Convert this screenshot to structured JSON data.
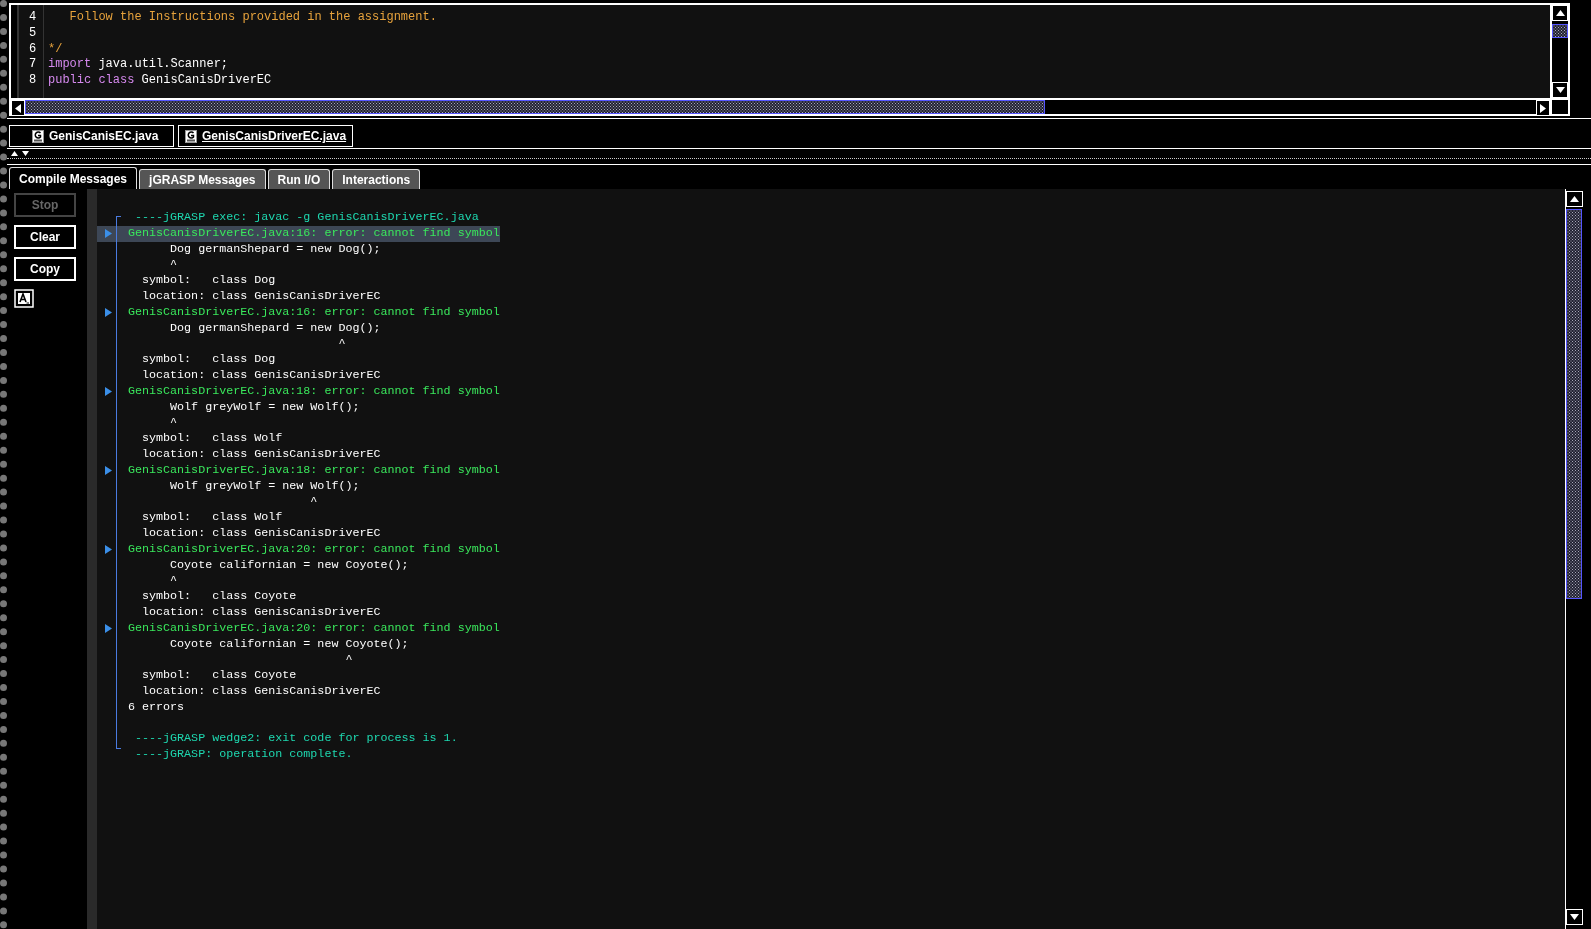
{
  "editor": {
    "lines": [
      {
        "number": "4",
        "tokens": [
          {
            "kind": "comment",
            "text": "   Follow the Instructions provided in the assignment."
          }
        ]
      },
      {
        "number": "5"
      },
      {
        "number": "6",
        "tokens": [
          {
            "kind": "comment",
            "text": "*/"
          }
        ]
      },
      {
        "number": "7",
        "tokens": [
          {
            "kind": "keyword",
            "text": "import"
          },
          {
            "kind": "plain",
            "text": " java.util.Scanner;"
          }
        ]
      },
      {
        "number": "8",
        "tokens": [
          {
            "kind": "keyword",
            "text": "public class"
          },
          {
            "kind": "plain",
            "text": " GenisCanisDriverEC"
          }
        ]
      }
    ]
  },
  "file_tabs": [
    {
      "label": "GenisCanisEC.java",
      "selected": false
    },
    {
      "label": "GenisCanisDriverEC.java",
      "selected": true
    }
  ],
  "tabs": [
    {
      "label": "Compile Messages",
      "selected": true
    },
    {
      "label": "jGRASP Messages",
      "selected": false
    },
    {
      "label": "Run I/O",
      "selected": false
    },
    {
      "label": "Interactions",
      "selected": false
    }
  ],
  "buttons": [
    {
      "label": "Stop",
      "disabled": true
    },
    {
      "label": "Clear",
      "disabled": false
    },
    {
      "label": "Copy",
      "disabled": false
    }
  ],
  "messages": [
    {
      "kind": "status",
      "text": " ----jGRASP exec: javac -g GenisCanisDriverEC.java"
    },
    {
      "kind": "error",
      "text": "GenisCanisDriverEC.java:16: error: cannot find symbol",
      "selected": true
    },
    {
      "kind": "plain",
      "text": "      Dog germanShepard = new Dog();"
    },
    {
      "kind": "plain",
      "text": "      ^"
    },
    {
      "kind": "plain",
      "text": "  symbol:   class Dog"
    },
    {
      "kind": "plain",
      "text": "  location: class GenisCanisDriverEC"
    },
    {
      "kind": "error",
      "text": "GenisCanisDriverEC.java:16: error: cannot find symbol",
      "selected": false
    },
    {
      "kind": "plain",
      "text": "      Dog germanShepard = new Dog();"
    },
    {
      "kind": "plain",
      "text": "                              ^"
    },
    {
      "kind": "plain",
      "text": "  symbol:   class Dog"
    },
    {
      "kind": "plain",
      "text": "  location: class GenisCanisDriverEC"
    },
    {
      "kind": "error",
      "text": "GenisCanisDriverEC.java:18: error: cannot find symbol",
      "selected": false
    },
    {
      "kind": "plain",
      "text": "      Wolf greyWolf = new Wolf();"
    },
    {
      "kind": "plain",
      "text": "      ^"
    },
    {
      "kind": "plain",
      "text": "  symbol:   class Wolf"
    },
    {
      "kind": "plain",
      "text": "  location: class GenisCanisDriverEC"
    },
    {
      "kind": "error",
      "text": "GenisCanisDriverEC.java:18: error: cannot find symbol",
      "selected": false
    },
    {
      "kind": "plain",
      "text": "      Wolf greyWolf = new Wolf();"
    },
    {
      "kind": "plain",
      "text": "                          ^"
    },
    {
      "kind": "plain",
      "text": "  symbol:   class Wolf"
    },
    {
      "kind": "plain",
      "text": "  location: class GenisCanisDriverEC"
    },
    {
      "kind": "error",
      "text": "GenisCanisDriverEC.java:20: error: cannot find symbol",
      "selected": false
    },
    {
      "kind": "plain",
      "text": "      Coyote californian = new Coyote();"
    },
    {
      "kind": "plain",
      "text": "      ^"
    },
    {
      "kind": "plain",
      "text": "  symbol:   class Coyote"
    },
    {
      "kind": "plain",
      "text": "  location: class GenisCanisDriverEC"
    },
    {
      "kind": "error",
      "text": "GenisCanisDriverEC.java:20: error: cannot find symbol",
      "selected": false
    },
    {
      "kind": "plain",
      "text": "      Coyote californian = new Coyote();"
    },
    {
      "kind": "plain",
      "text": "                               ^"
    },
    {
      "kind": "plain",
      "text": "  symbol:   class Coyote"
    },
    {
      "kind": "plain",
      "text": "  location: class GenisCanisDriverEC"
    },
    {
      "kind": "plain",
      "text": "6 errors"
    },
    {
      "kind": "blank"
    },
    {
      "kind": "status",
      "text": " ----jGRASP wedge2: exit code for process is 1."
    },
    {
      "kind": "status",
      "text": " ----jGRASP: operation complete."
    }
  ]
}
